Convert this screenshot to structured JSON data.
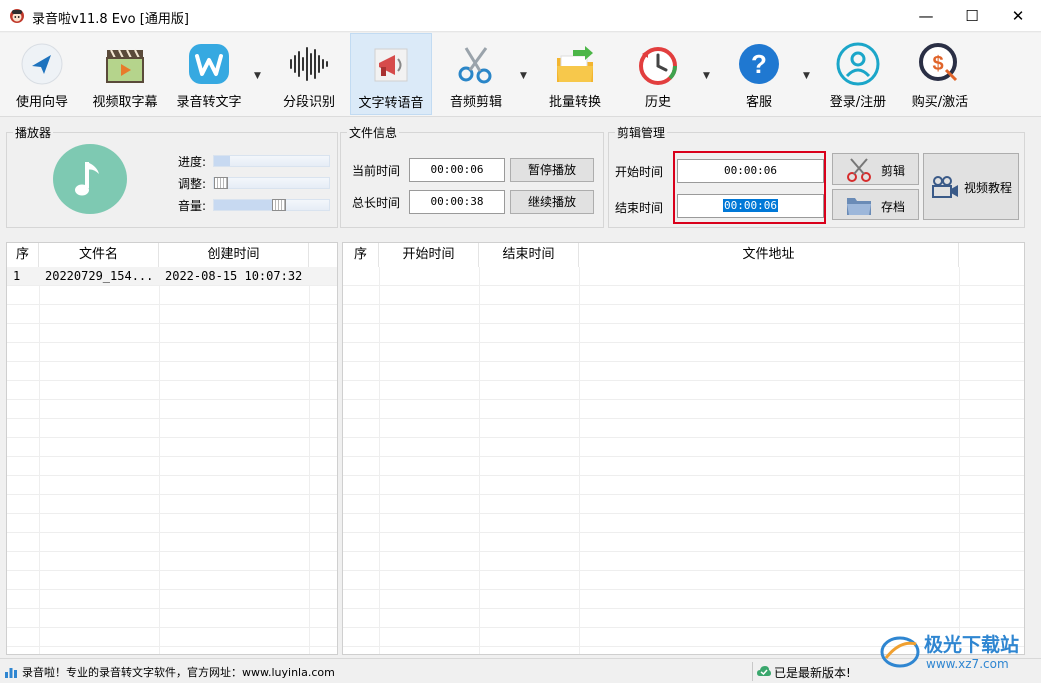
{
  "window": {
    "title": "录音啦v11.8 Evo [通用版]",
    "controls": {
      "minimize": "—",
      "maximize": "☐",
      "close": "✕"
    }
  },
  "toolbar": {
    "items": [
      {
        "label": "使用向导",
        "icon": "navigation-arrow-icon"
      },
      {
        "label": "视频取字幕",
        "icon": "clapperboard-play-icon"
      },
      {
        "label": "录音转文字",
        "icon": "w-badge-icon",
        "dropdown": true
      },
      {
        "label": "分段识别",
        "icon": "waveform-icon"
      },
      {
        "label": "文字转语音",
        "icon": "megaphone-icon",
        "active": true
      },
      {
        "label": "音频剪辑",
        "icon": "scissors-icon",
        "dropdown": true
      },
      {
        "label": "批量转换",
        "icon": "folder-arrow-icon"
      },
      {
        "label": "历史",
        "icon": "history-clock-icon",
        "dropdown": true
      },
      {
        "label": "客服",
        "icon": "help-question-icon",
        "dropdown": true
      },
      {
        "label": "登录/注册",
        "icon": "user-login-icon"
      },
      {
        "label": "购买/激活",
        "icon": "purchase-coin-icon"
      }
    ]
  },
  "player": {
    "group_title": "播放器",
    "progress_label": "进度:",
    "adjust_label": "调整:",
    "volume_label": "音量:",
    "progress_value": 0.14,
    "adjust_value": 0.0,
    "volume_value": 0.56
  },
  "file_info": {
    "group_title": "文件信息",
    "current_time_label": "当前时间",
    "current_time": "00:00:06",
    "total_time_label": "总长时间",
    "total_time": "00:00:38",
    "pause_button": "暂停播放",
    "resume_button": "继续播放"
  },
  "clip": {
    "group_title": "剪辑管理",
    "start_label": "开始时间",
    "start_time": "00:00:06",
    "end_label": "结束时间",
    "end_time": "00:00:06",
    "cut_button": "剪辑",
    "save_button": "存档",
    "tutorial_button": "视频教程"
  },
  "file_list": {
    "headers": [
      "序",
      "文件名",
      "创建时间"
    ],
    "rows": [
      {
        "index": "1",
        "name": "20220729_154...",
        "created": "2022-08-15 10:07:32"
      }
    ]
  },
  "clip_list": {
    "headers": [
      "序",
      "开始时间",
      "结束时间",
      "文件地址"
    ],
    "rows": []
  },
  "status": {
    "left": "录音啦！专业的录音转文字软件，官方网址：www.luyinla.com",
    "right": "已是最新版本!"
  },
  "watermark": {
    "text": "极光下载站",
    "url": "www.xz7.com"
  },
  "colors": {
    "selection": "#0078d7",
    "highlight": "#d9001b",
    "active_tab": "#dbeaf8"
  }
}
